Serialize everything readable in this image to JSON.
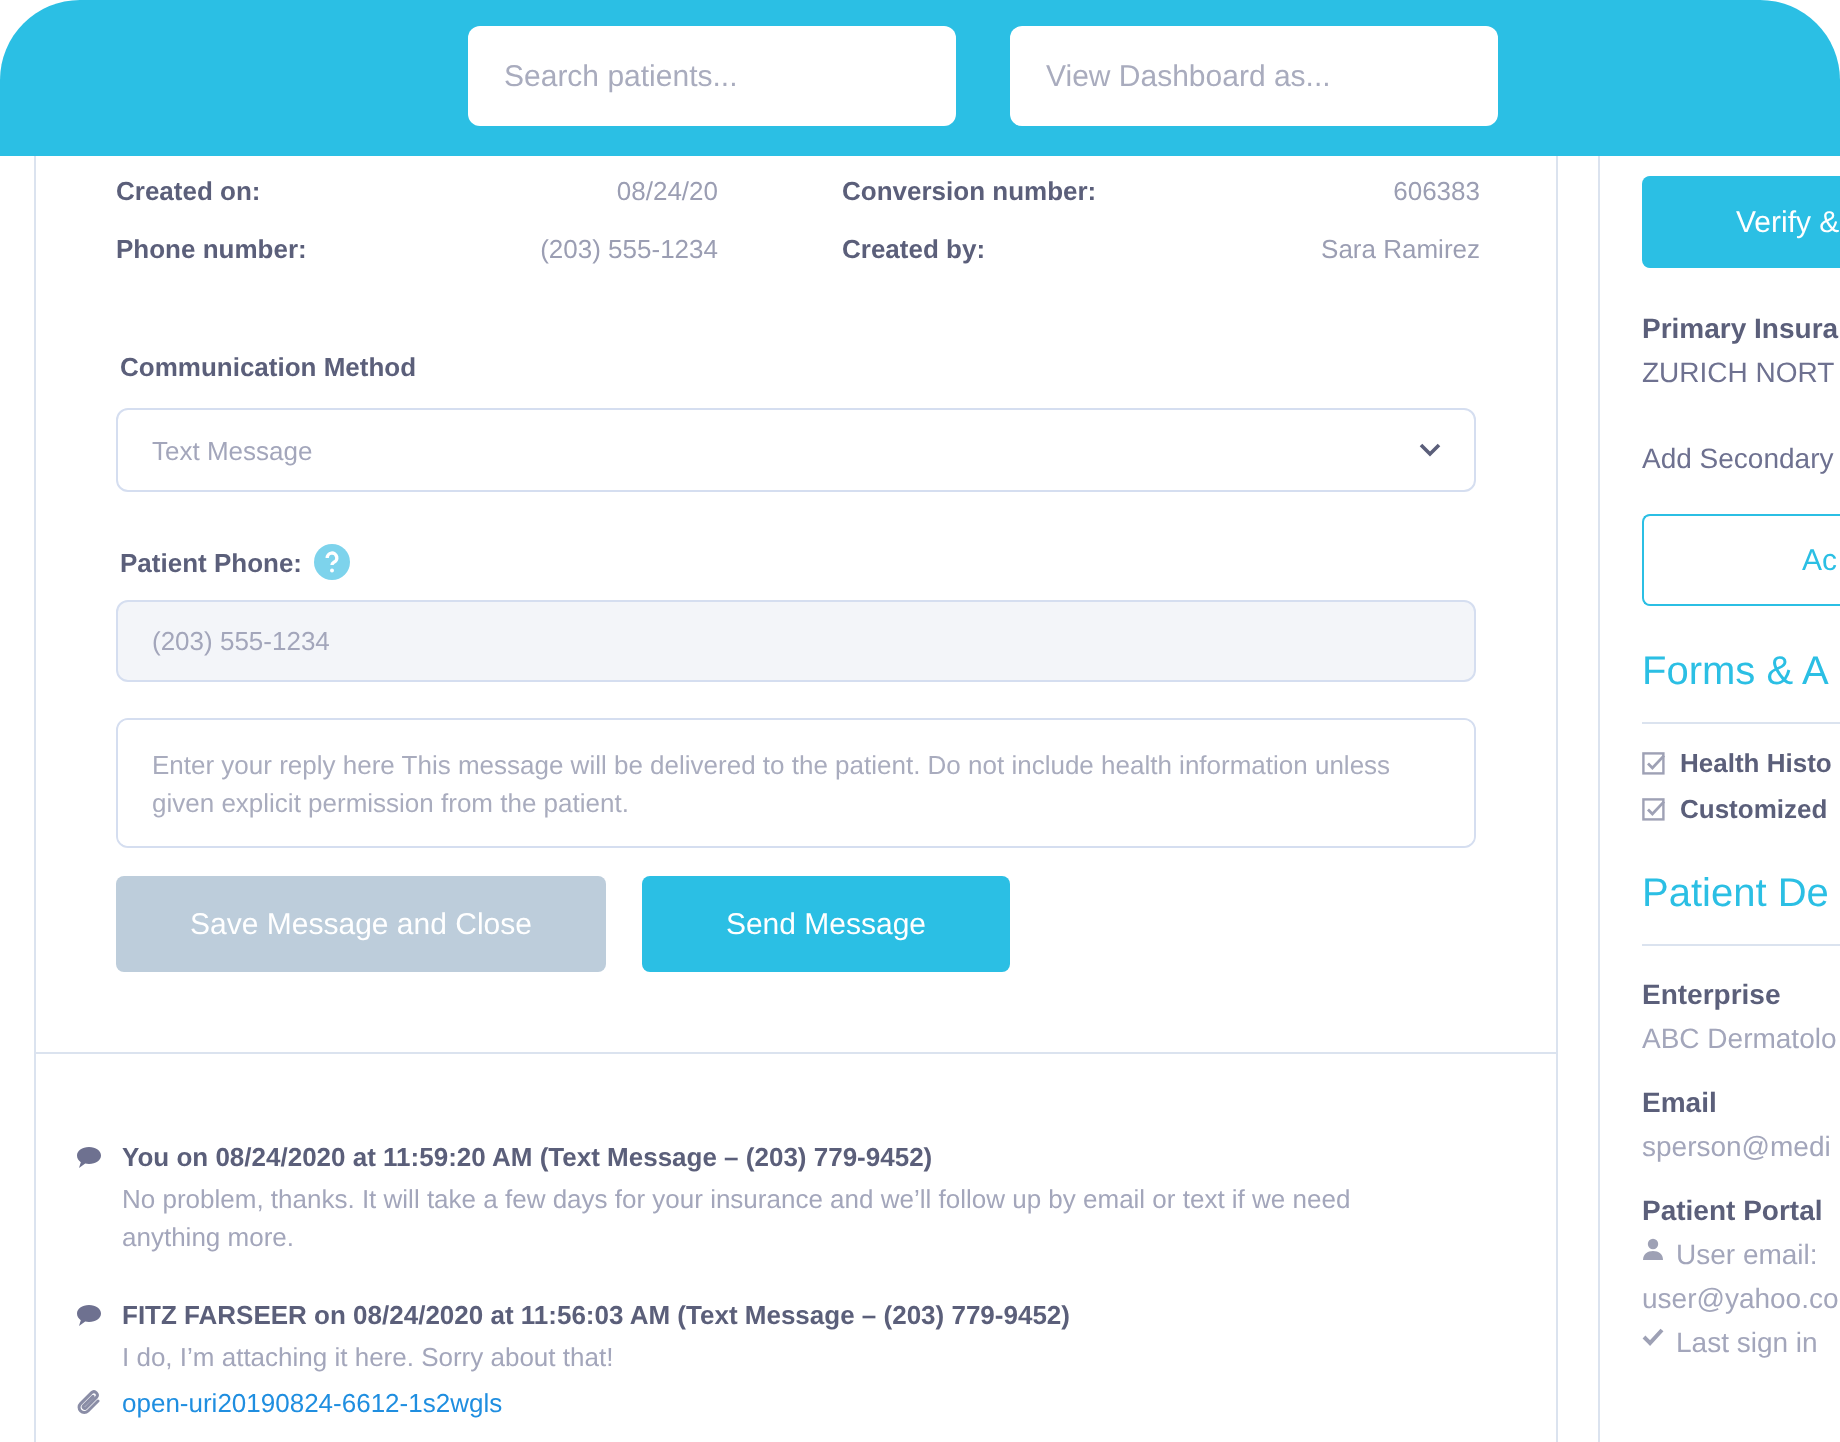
{
  "header": {
    "search": {
      "placeholder": "Search patients..."
    },
    "view_as": {
      "placeholder": "View Dashboard as..."
    }
  },
  "details": [
    {
      "label": "Created on:",
      "value": "08/24/20"
    },
    {
      "label": "Conversion number:",
      "value": "606383"
    },
    {
      "label": "Phone number:",
      "value": "(203) 555-1234"
    },
    {
      "label": "Created by:",
      "value": "Sara Ramirez"
    }
  ],
  "communication": {
    "label": "Communication Method",
    "value": "Text Message"
  },
  "patient_phone": {
    "label": "Patient Phone:",
    "value": "(203) 555-1234",
    "disabled": true
  },
  "reply": {
    "placeholder": "Enter your reply here This message will be delivered to the patient. Do not include health information unless given explicit permission from the patient."
  },
  "buttons": [
    {
      "label": "Save Message and Close",
      "disabled": true
    },
    {
      "label": "Send Message",
      "disabled": false
    }
  ],
  "messages": [
    {
      "header": "You on 08/24/2020 at 11:59:20 AM (Text Message – (203) 779-9452)",
      "body": "No problem, thanks. It will take a few days for your insurance and we’ll follow up by email or text if we need anything more."
    },
    {
      "header": "FITZ FARSEER on 08/24/2020 at 11:56:03 AM (Text Message – (203) 779-9452)",
      "body": "I do, I’m attaching it here. Sorry about that!",
      "attachment": "open-uri20190824-6612-1s2wgls"
    }
  ],
  "sidebar": {
    "verify_button": "Verify &",
    "primary_insurance": {
      "label": "Primary Insura",
      "value": "ZURICH NORT"
    },
    "add_secondary": "Add Secondary",
    "add_button": "Ac",
    "forms": {
      "heading": "Forms & A",
      "items": [
        {
          "label": "Health Histo",
          "checked": true
        },
        {
          "label": "Customized",
          "checked": true
        }
      ]
    },
    "patient_details": {
      "heading": "Patient De",
      "fields": [
        {
          "label": "Enterprise",
          "value": "ABC Dermatolo"
        },
        {
          "label": "Email",
          "value": "sperson@medi"
        }
      ],
      "portal": {
        "label": "Patient Portal",
        "items": [
          {
            "kind": "user",
            "text": "User email:"
          },
          {
            "kind": "plain",
            "text": "user@yahoo.co"
          },
          {
            "kind": "check",
            "text": "Last sign in"
          }
        ]
      }
    }
  }
}
